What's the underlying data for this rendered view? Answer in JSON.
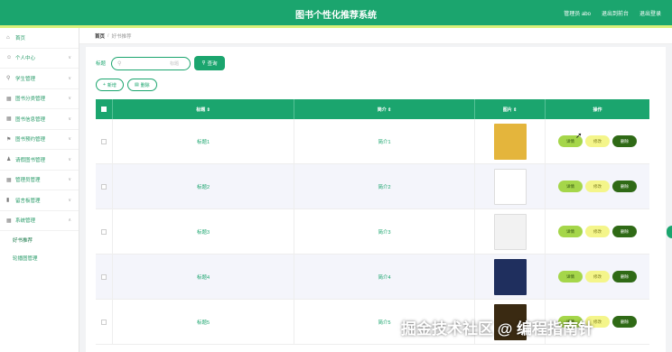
{
  "header": {
    "title": "图书个性化推荐系统",
    "links": [
      "管理员 abo",
      "退出到前台",
      "退出登录"
    ]
  },
  "sidebar": {
    "items": [
      {
        "label": "首页",
        "icon": "home-icon"
      },
      {
        "label": "个人中心",
        "icon": "user-icon"
      },
      {
        "label": "学生管理",
        "icon": "location-icon"
      },
      {
        "label": "图书分类管理",
        "icon": "grid-icon"
      },
      {
        "label": "图书信息管理",
        "icon": "grid-icon"
      },
      {
        "label": "图书预约管理",
        "icon": "flag-icon"
      },
      {
        "label": "请假图书管理",
        "icon": "person-icon"
      },
      {
        "label": "管理员管理",
        "icon": "grid-icon"
      },
      {
        "label": "留言板管理",
        "icon": "chart-icon"
      },
      {
        "label": "系统管理",
        "icon": "grid-icon"
      }
    ],
    "subitems": [
      "好书推荐",
      "轮播图管理"
    ]
  },
  "breadcrumb": {
    "home": "首页",
    "separator": "/",
    "current": "好书推荐"
  },
  "search": {
    "label": "标题",
    "placeholder": "标题",
    "button": "查询"
  },
  "actions": {
    "add": "新增",
    "delete": "删除"
  },
  "table": {
    "headers": [
      "标题 ⇕",
      "简介 ⇕",
      "图片 ⇕",
      "操作"
    ],
    "rows": [
      {
        "title": "标题1",
        "intro": "简介1",
        "cover_color": "#e4b53c"
      },
      {
        "title": "标题2",
        "intro": "简介2",
        "cover_color": "#ffffff"
      },
      {
        "title": "标题3",
        "intro": "简介3",
        "cover_color": "#f2f2f2"
      },
      {
        "title": "标题4",
        "intro": "简介4",
        "cover_color": "#1f2f5e"
      },
      {
        "title": "标题5",
        "intro": "简介5",
        "cover_color": "#3a2a12"
      }
    ],
    "ops": {
      "detail": "详情",
      "edit": "修改",
      "delete": "删除"
    }
  },
  "watermark": "掘金技术社区 @ 编程指南针",
  "colors": {
    "primary": "#1ba56e",
    "accent_line": "#d9f07a",
    "detail": "#a5d64a",
    "edit": "#f4f58a",
    "delete": "#2f6a16"
  }
}
